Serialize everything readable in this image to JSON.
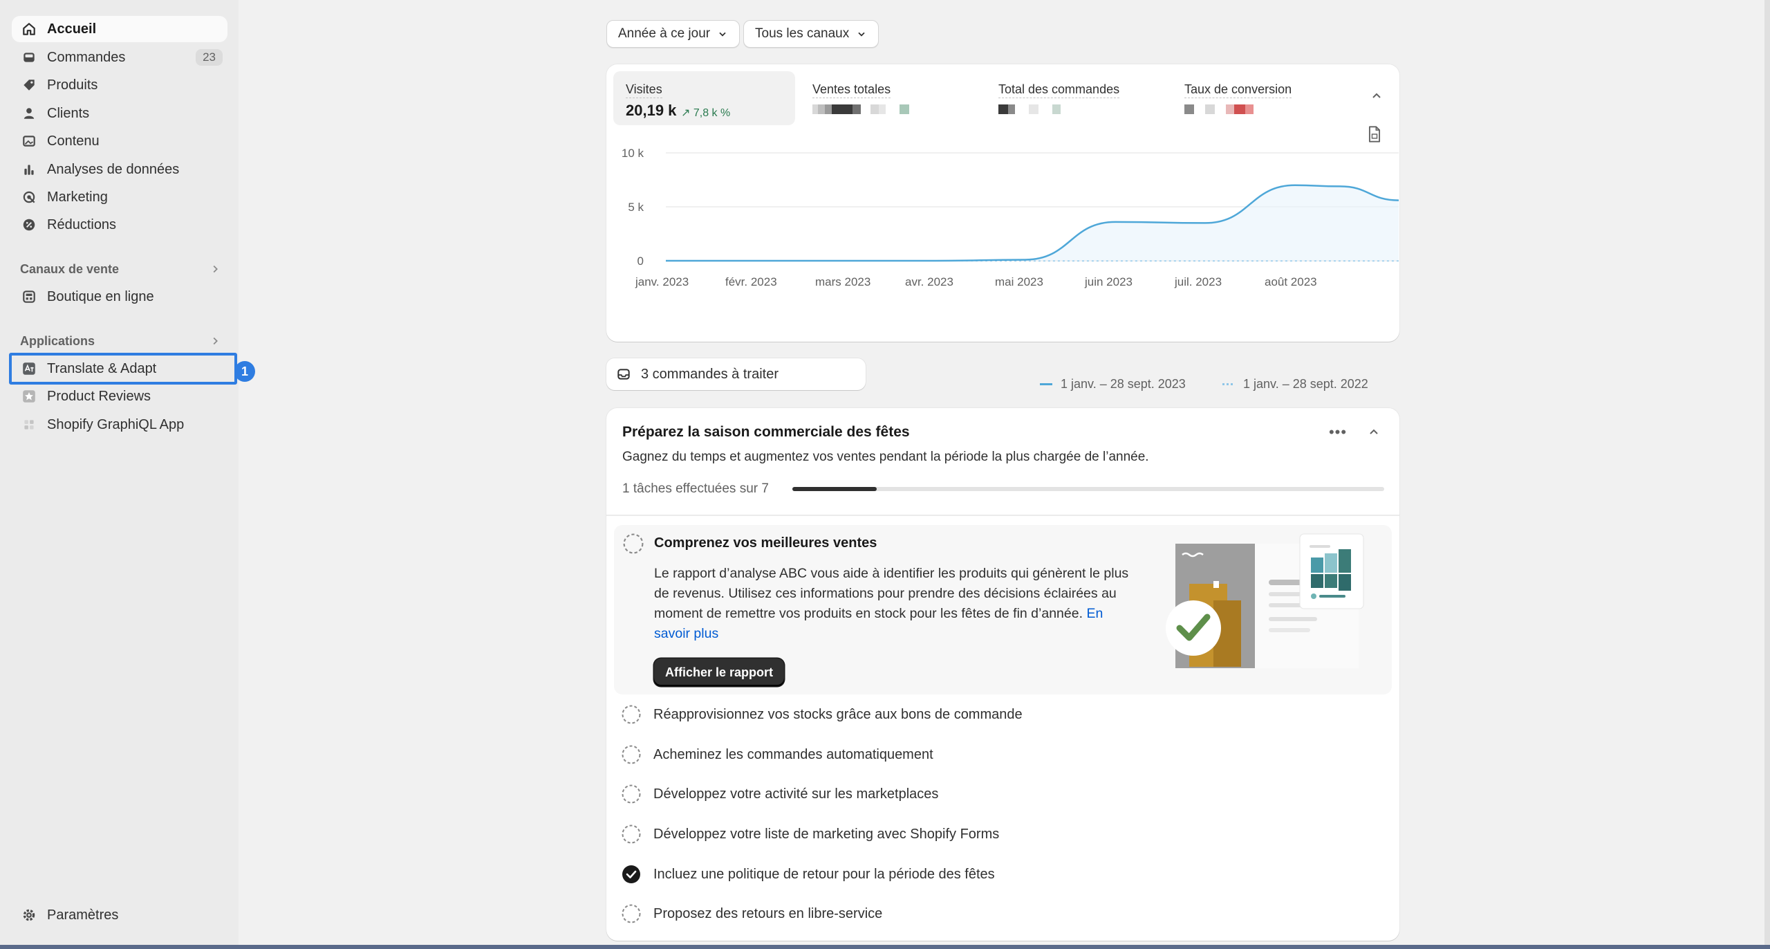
{
  "sidebar": {
    "items": [
      {
        "label": "Accueil",
        "icon": "home-icon"
      },
      {
        "label": "Commandes",
        "icon": "inbox-icon",
        "count": "23"
      },
      {
        "label": "Produits",
        "icon": "tag-icon"
      },
      {
        "label": "Clients",
        "icon": "person-icon"
      },
      {
        "label": "Contenu",
        "icon": "image-icon"
      },
      {
        "label": "Analyses de données",
        "icon": "bar-chart-icon"
      },
      {
        "label": "Marketing",
        "icon": "target-icon"
      },
      {
        "label": "Réductions",
        "icon": "discount-icon"
      }
    ],
    "sales_channels_title": "Canaux de vente",
    "sales_channels": [
      {
        "label": "Boutique en ligne",
        "icon": "store-icon"
      }
    ],
    "apps_title": "Applications",
    "apps": [
      {
        "label": "Translate & Adapt",
        "icon": "translate-icon"
      },
      {
        "label": "Product Reviews",
        "icon": "star-icon"
      },
      {
        "label": "Shopify GraphiQL App",
        "icon": "graphql-icon"
      }
    ],
    "settings_label": "Paramètres",
    "highlight_badge": "1"
  },
  "filters": {
    "period": "Année à ce jour",
    "channels": "Tous les canaux"
  },
  "metrics": [
    {
      "label": "Visites",
      "value": "20,19 k",
      "delta": "7,8 k %"
    },
    {
      "label": "Ventes totales"
    },
    {
      "label": "Total des commandes"
    },
    {
      "label": "Taux de conversion"
    }
  ],
  "chart_data": {
    "type": "line",
    "x": [
      "janv. 2023",
      "févr. 2023",
      "mars 2023",
      "avr. 2023",
      "mai 2023",
      "juin 2023",
      "juil. 2023",
      "août 2023"
    ],
    "y_ticks": [
      "10 k",
      "5 k",
      "0"
    ],
    "ylim": [
      0,
      10000
    ],
    "series": [
      {
        "name": "1 janv. – 28 sept. 2023",
        "color": "#4ea7d8",
        "style": "solid",
        "points": [
          [
            0,
            0
          ],
          [
            1,
            0
          ],
          [
            2,
            0
          ],
          [
            3,
            0
          ],
          [
            4,
            100
          ],
          [
            5,
            3600
          ],
          [
            6,
            3500
          ],
          [
            7,
            7000
          ],
          [
            7.5,
            6900
          ],
          [
            8,
            5600
          ]
        ]
      },
      {
        "name": "1 janv. – 28 sept. 2022",
        "color": "#8fc6e8",
        "style": "dotted",
        "points": [
          [
            0,
            0
          ],
          [
            8,
            0
          ]
        ]
      }
    ]
  },
  "pill": {
    "label": "3 commandes à traiter"
  },
  "setup": {
    "title": "Préparez la saison commerciale des fêtes",
    "subtitle": "Gagnez du temps et augmentez vos ventes pendant la période la plus chargée de l’année.",
    "progress_text": "1 tâches effectuées sur 7",
    "progress": 0.143,
    "expanded_task": {
      "title": "Comprenez vos meilleures ventes",
      "body": "Le rapport d’analyse ABC vous aide à identifier les produits qui génèrent le plus de revenus. Utilisez ces informations pour prendre des décisions éclairées au moment de remettre vos produits en stock pour les fêtes de fin d’année.",
      "link": "En savoir plus",
      "button": "Afficher le rapport"
    },
    "tasks": [
      {
        "label": "Réapprovisionnez vos stocks grâce aux bons de commande",
        "done": false
      },
      {
        "label": "Acheminez les commandes automatiquement",
        "done": false
      },
      {
        "label": "Développez votre activité sur les marketplaces",
        "done": false
      },
      {
        "label": "Développez votre liste de marketing avec Shopify Forms",
        "done": false
      },
      {
        "label": "Incluez une politique de retour pour la période des fêtes",
        "done": true
      },
      {
        "label": "Proposez des retours en libre-service",
        "done": false
      }
    ]
  }
}
